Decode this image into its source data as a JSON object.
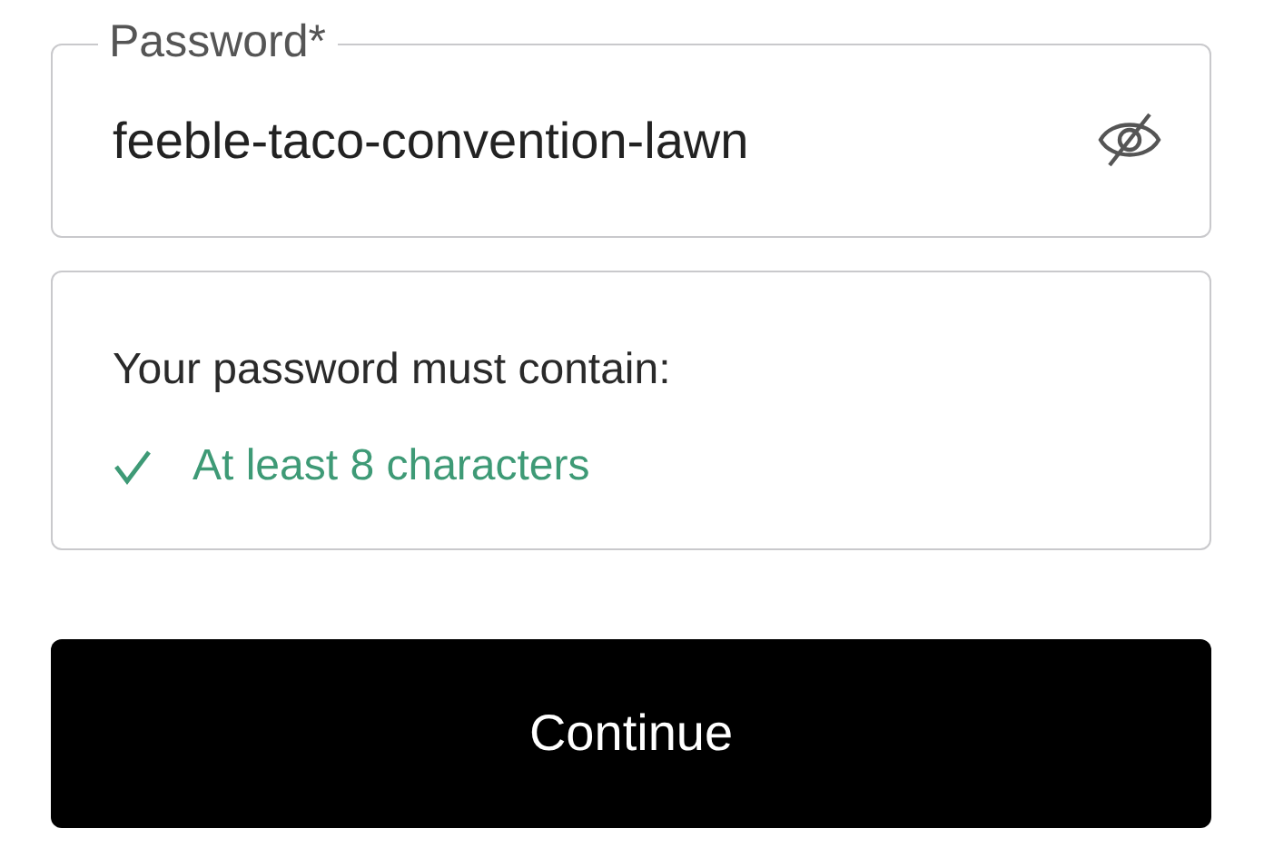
{
  "password_field": {
    "label": "Password*",
    "value": "feeble-taco-convention-lawn",
    "visible": true
  },
  "requirements": {
    "heading": "Your password must contain:",
    "items": [
      {
        "text": "At least 8 characters",
        "met": true
      }
    ]
  },
  "continue_button": {
    "label": "Continue"
  }
}
